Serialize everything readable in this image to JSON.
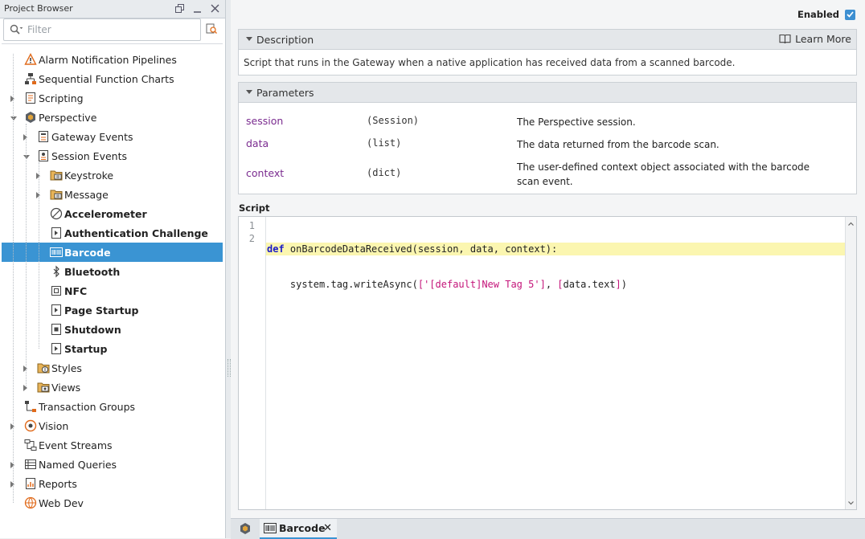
{
  "left_panel": {
    "title": "Project Browser",
    "filter_placeholder": "Filter",
    "tree": [
      {
        "label": "Alarm Notification Pipelines",
        "icon": "alarm-pipeline-icon",
        "bold": false
      },
      {
        "label": "Sequential Function Charts",
        "icon": "sfc-icon",
        "bold": false
      },
      {
        "label": "Scripting",
        "icon": "script-icon",
        "bold": false
      },
      {
        "label": "Perspective",
        "icon": "perspective-icon",
        "bold": false
      },
      {
        "label": "Gateway Events",
        "icon": "gateway-events-icon",
        "bold": false
      },
      {
        "label": "Session Events",
        "icon": "session-events-icon",
        "bold": false
      },
      {
        "label": "Keystroke",
        "icon": "folder-icon",
        "bold": false
      },
      {
        "label": "Message",
        "icon": "folder-icon",
        "bold": false
      },
      {
        "label": "Accelerometer",
        "icon": "accelerometer-icon",
        "bold": true
      },
      {
        "label": "Authentication Challenge",
        "icon": "script-event-icon",
        "bold": true
      },
      {
        "label": "Barcode",
        "icon": "barcode-icon",
        "bold": true
      },
      {
        "label": "Bluetooth",
        "icon": "bluetooth-icon",
        "bold": true
      },
      {
        "label": "NFC",
        "icon": "nfc-icon",
        "bold": true
      },
      {
        "label": "Page Startup",
        "icon": "script-event-icon",
        "bold": true
      },
      {
        "label": "Shutdown",
        "icon": "shutdown-icon",
        "bold": true
      },
      {
        "label": "Startup",
        "icon": "script-event-icon",
        "bold": true
      },
      {
        "label": "Styles",
        "icon": "styles-folder-icon",
        "bold": false
      },
      {
        "label": "Views",
        "icon": "views-folder-icon",
        "bold": false
      },
      {
        "label": "Transaction Groups",
        "icon": "transaction-groups-icon",
        "bold": false
      },
      {
        "label": "Vision",
        "icon": "vision-icon",
        "bold": false
      },
      {
        "label": "Event Streams",
        "icon": "event-streams-icon",
        "bold": false
      },
      {
        "label": "Named Queries",
        "icon": "named-queries-icon",
        "bold": false
      },
      {
        "label": "Reports",
        "icon": "reports-icon",
        "bold": false
      },
      {
        "label": "Web Dev",
        "icon": "web-dev-icon",
        "bold": false
      }
    ]
  },
  "enabled_label": "Enabled",
  "description": {
    "header": "Description",
    "learn_more": "Learn More",
    "text": "Script that runs in the Gateway when a native application has received data from a scanned barcode."
  },
  "parameters": {
    "header": "Parameters",
    "rows": [
      {
        "name": "session",
        "type": "(Session)",
        "desc": "The Perspective session."
      },
      {
        "name": "data",
        "type": "(list)",
        "desc": "The data returned from the barcode scan."
      },
      {
        "name": "context",
        "type": "(dict)",
        "desc": "The user-defined context object associated with the barcode scan event."
      }
    ]
  },
  "script": {
    "label": "Script",
    "line_numbers": [
      "1",
      "2"
    ],
    "line1": {
      "kw": "def",
      "rest": " onBarcodeDataReceived(session, data, context):"
    },
    "line2": {
      "pre": "    system.tag.writeAsync(",
      "b1": "[",
      "s": "'[default]New Tag 5'",
      "b2": "]",
      "mid": ", ",
      "b3": "[",
      "inner": "data.text",
      "b4": "]",
      "post": ")"
    }
  },
  "bottom_tab": {
    "label": "Barcode",
    "close": "✕"
  },
  "colors": {
    "accent": "#3a94d3",
    "param_name": "#7a2b8f",
    "keyword": "#1a1ac6",
    "string": "#c4157a",
    "highlight": "#fbf6b0"
  }
}
